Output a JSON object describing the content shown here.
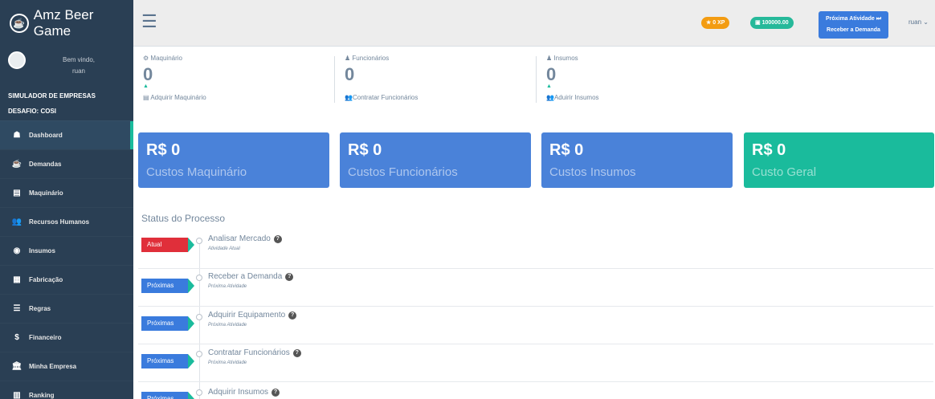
{
  "app": {
    "title": "Amz Beer Game",
    "logo_icon": "beer-icon"
  },
  "profile": {
    "welcome": "Bem vindo,",
    "username": "ruan"
  },
  "sidebar": {
    "simulator_label": "SIMULADOR DE EMPRESAS",
    "challenge_label": "DESAFIO: COSI",
    "items": [
      {
        "label": "Dashboard",
        "icon": "dashboard-icon",
        "glyph": "☗"
      },
      {
        "label": "Demandas",
        "icon": "beer-icon",
        "glyph": "☕"
      },
      {
        "label": "Maquinário",
        "icon": "machine-icon",
        "glyph": "▤"
      },
      {
        "label": "Recursos Humanos",
        "icon": "users-icon",
        "glyph": "👥"
      },
      {
        "label": "Insumos",
        "icon": "circle-icon",
        "glyph": "◉"
      },
      {
        "label": "Fabricação",
        "icon": "factory-icon",
        "glyph": "▦"
      },
      {
        "label": "Regras",
        "icon": "database-icon",
        "glyph": "☰"
      },
      {
        "label": "Financeiro",
        "icon": "dollar-icon",
        "glyph": "$"
      },
      {
        "label": "Minha Empresa",
        "icon": "bank-icon",
        "glyph": "🏛"
      },
      {
        "label": "Ranking",
        "icon": "chart-icon",
        "glyph": "▥"
      }
    ]
  },
  "topbar": {
    "xp": "0 XP",
    "money": "100000.00",
    "next_activity_label": "Próxima Atividade",
    "next_activity_name": "Receber a Demanda",
    "user": "ruan"
  },
  "counters": [
    {
      "label": "Maquinário",
      "value": "0",
      "link": "Adquirir Maquinário"
    },
    {
      "label": "Funcionários",
      "value": "0",
      "link": "Contratar Funcionários"
    },
    {
      "label": "Insumos",
      "value": "0",
      "link": "Aduirir Insumos"
    }
  ],
  "costs": [
    {
      "value": "R$ 0",
      "label": "Custos Maquinário",
      "color": "#4a82d9"
    },
    {
      "value": "R$ 0",
      "label": "Custos Funcionários",
      "color": "#4a82d9"
    },
    {
      "value": "R$ 0",
      "label": "Custos Insumos",
      "color": "#4a82d9"
    },
    {
      "value": "R$ 0",
      "label": "Custo Geral",
      "color": "#1abb9c"
    }
  ],
  "process": {
    "title": "Status do Processo",
    "steps": [
      {
        "badge": "Atual",
        "badge_color": "#e02f3a",
        "title": "Analisar Mercado",
        "subtitle": "Atividade Atual"
      },
      {
        "badge": "Próximas",
        "badge_color": "#3a7bdd",
        "title": "Receber a Demanda",
        "subtitle": "Próxima Atividade"
      },
      {
        "badge": "Próximas",
        "badge_color": "#3a7bdd",
        "title": "Adquirir Equipamento",
        "subtitle": "Próxima Atividade"
      },
      {
        "badge": "Próximas",
        "badge_color": "#3a7bdd",
        "title": "Contratar Funcionários",
        "subtitle": "Próxima Atividade"
      },
      {
        "badge": "Próximas",
        "badge_color": "#3a7bdd",
        "title": "Adquirir Insumos",
        "subtitle": ""
      }
    ]
  }
}
